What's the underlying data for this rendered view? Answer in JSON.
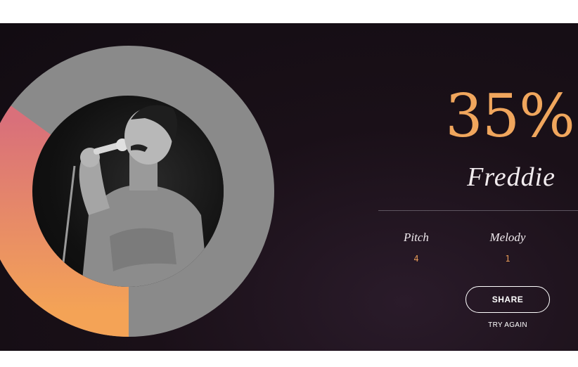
{
  "result": {
    "score_percent": 35,
    "score_label": "35%",
    "artist": "Freddie"
  },
  "stats": {
    "pitch_label": "Pitch",
    "pitch_value": "4",
    "melody_label": "Melody",
    "melody_value": "1"
  },
  "actions": {
    "share_label": "SHARE",
    "try_again_label": "TRY AGAIN"
  },
  "colors": {
    "accent": "#f0a65d",
    "ring_track": "#8a8a8a",
    "ring_gradient_start": "#f4a356",
    "ring_gradient_end": "#d9707a",
    "background": "#150f15"
  }
}
